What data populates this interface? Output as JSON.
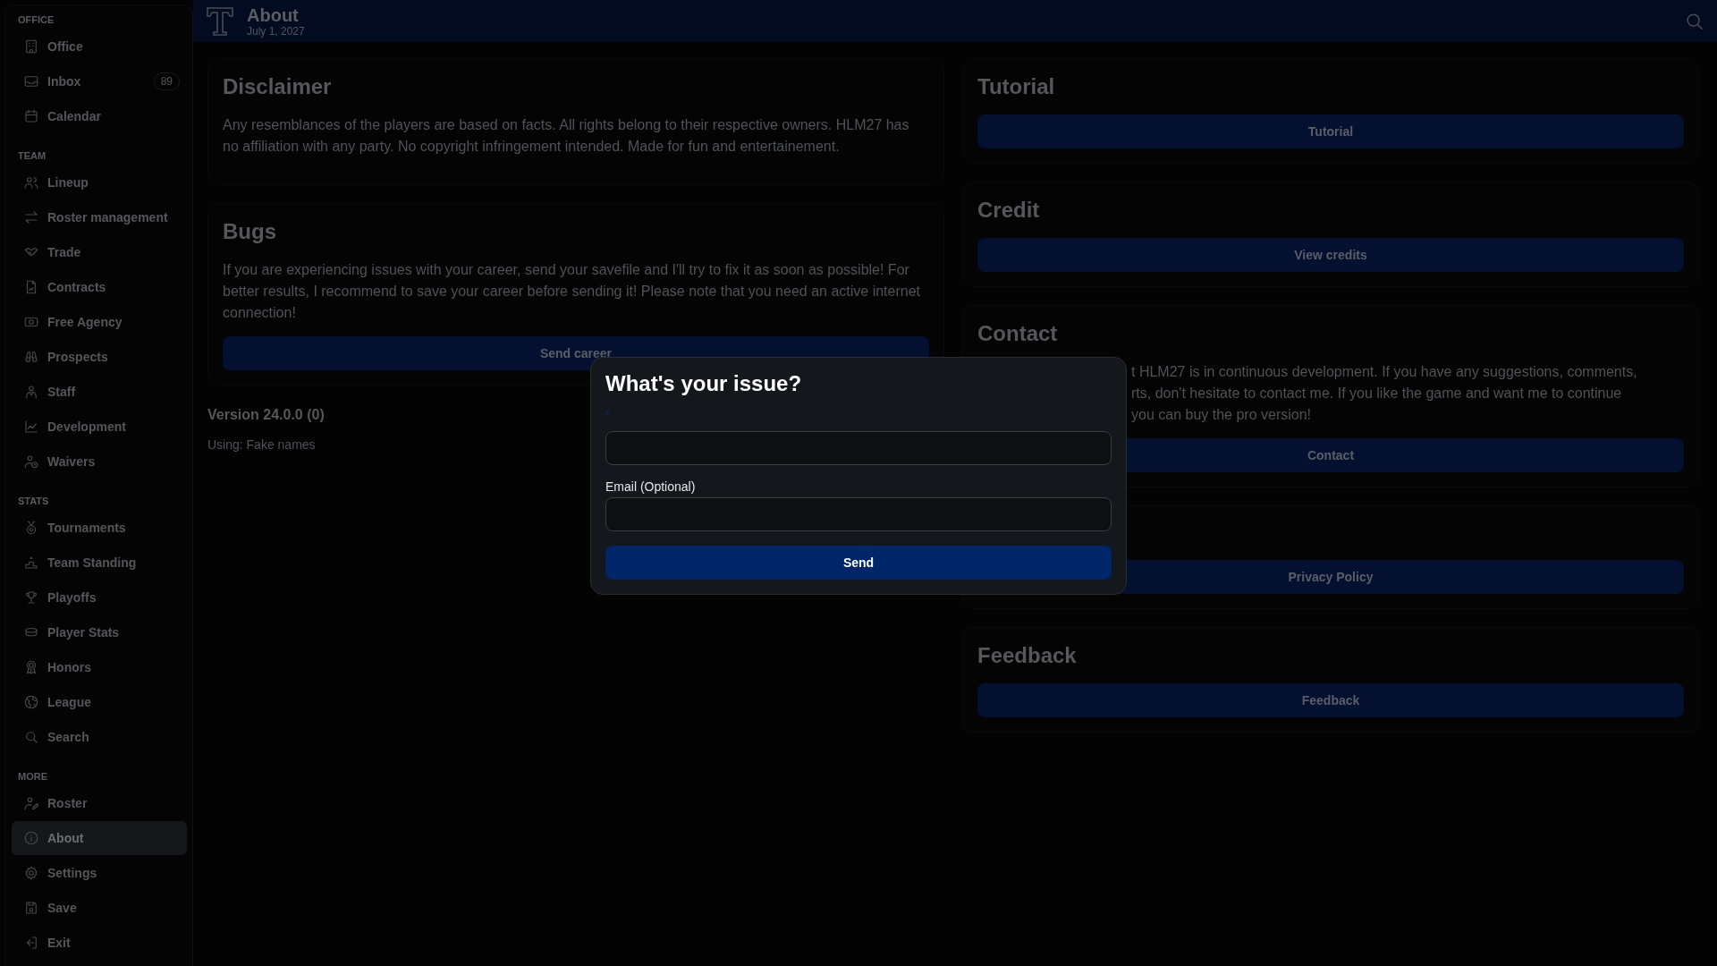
{
  "header": {
    "title": "About",
    "date": "July 1, 2027"
  },
  "sidebar": {
    "sections": [
      {
        "title": "OFFICE",
        "items": [
          {
            "label": "Office",
            "selected": false
          },
          {
            "label": "Inbox",
            "selected": false,
            "badge": "89"
          },
          {
            "label": "Calendar",
            "selected": false
          }
        ]
      },
      {
        "title": "TEAM",
        "items": [
          {
            "label": "Lineup",
            "selected": false
          },
          {
            "label": "Roster management",
            "selected": false
          },
          {
            "label": "Trade",
            "selected": false
          },
          {
            "label": "Contracts",
            "selected": false
          },
          {
            "label": "Free Agency",
            "selected": false
          },
          {
            "label": "Prospects",
            "selected": false
          },
          {
            "label": "Staff",
            "selected": false
          },
          {
            "label": "Development",
            "selected": false
          },
          {
            "label": "Waivers",
            "selected": false
          }
        ]
      },
      {
        "title": "STATS",
        "items": [
          {
            "label": "Tournaments",
            "selected": false
          },
          {
            "label": "Team Standing",
            "selected": false
          },
          {
            "label": "Playoffs",
            "selected": false
          },
          {
            "label": "Player Stats",
            "selected": false
          },
          {
            "label": "Honors",
            "selected": false
          },
          {
            "label": "League",
            "selected": false
          },
          {
            "label": "Search",
            "selected": false
          }
        ]
      },
      {
        "title": "MORE",
        "items": [
          {
            "label": "Roster",
            "selected": false
          },
          {
            "label": "About",
            "selected": true
          },
          {
            "label": "Settings",
            "selected": false
          },
          {
            "label": "Save",
            "selected": false
          },
          {
            "label": "Exit",
            "selected": false
          }
        ]
      }
    ]
  },
  "left_cards": [
    {
      "title": "Disclaimer",
      "text": "Any resemblances of the players are based on facts. All rights belong to their respective owners. HLM27 has no affiliation with any party. No copyright infringement intended. Made for fun and entertainement."
    },
    {
      "title": "Bugs",
      "text": "If you are experiencing issues with your career, send your savefile and I'll try to fix it as soon as possible! For better results, I recommend to save your career before sending it! Please note that you need an active internet connection!",
      "button": "Send career"
    }
  ],
  "version": "Version 24.0.0 (0)",
  "names_mode": "Using: Fake names",
  "right_cards": [
    {
      "title": "Tutorial",
      "button": "Tutorial"
    },
    {
      "title": "Credit",
      "button": "View credits"
    },
    {
      "title": "Contact",
      "text_lines": [
        "t HLM27 is in continuous development. If you have any suggestions, comments,",
        "rts, don't hesitate to contact me. If you like the game and want me to continue",
        "you can buy the pro version!"
      ],
      "button": "Contact"
    },
    {
      "button": "Privacy Policy"
    },
    {
      "title": "Feedback",
      "button": "Feedback"
    }
  ],
  "modal": {
    "title": "What's your issue?",
    "required_mark": "*",
    "email_label": "Email (Optional)",
    "button": "Send"
  }
}
